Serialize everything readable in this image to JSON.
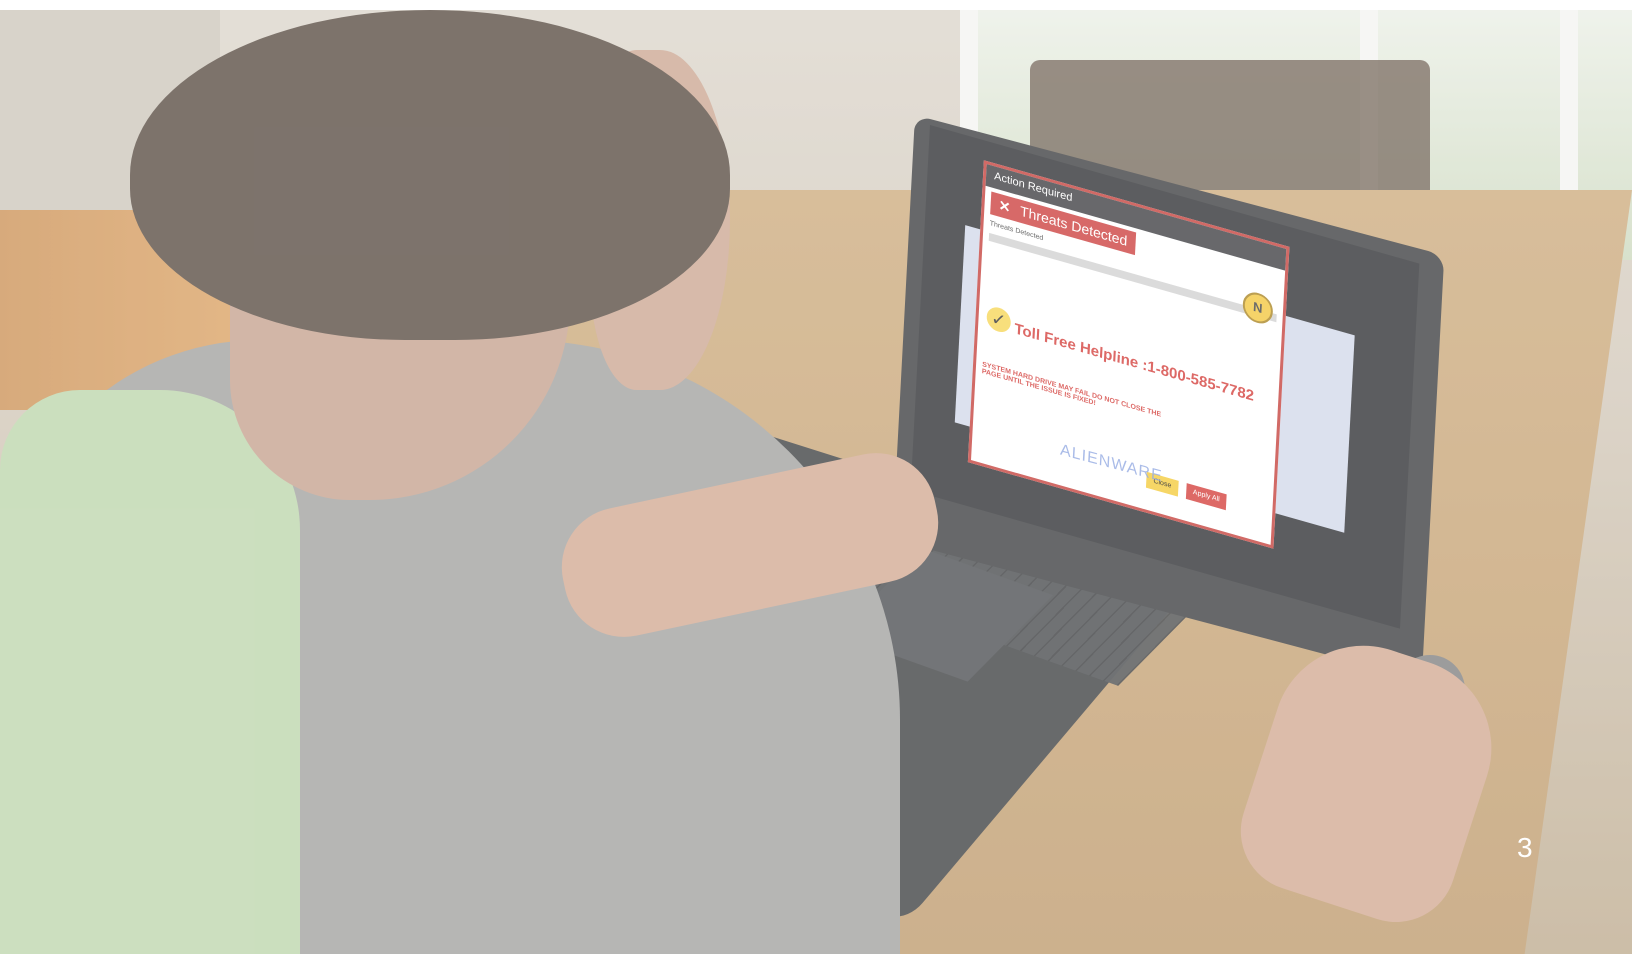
{
  "screen_popup": {
    "titlebar": "Action Required",
    "banner": "Threats Detected",
    "subtitle": "Threats Detected",
    "helpline": "Toll Free Helpline :1-800-585-7782",
    "warning": "SYSTEM HARD DRIVE MAY FAIL DO NOT CLOSE THE PAGE UNTIL THE ISSUE IS FIXED!",
    "close_label": "Close",
    "apply_label": "Apply All",
    "shield_letter": "N"
  },
  "laptop": {
    "brand": "ALIENWARE"
  },
  "page": {
    "number": "3"
  },
  "colors": {
    "alert_red": "#c8302e",
    "alert_yellow": "#f3c62b"
  }
}
